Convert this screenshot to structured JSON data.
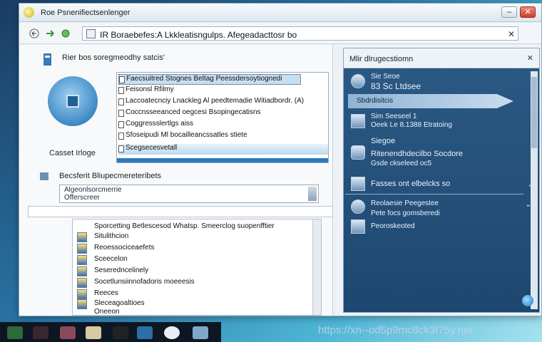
{
  "window": {
    "title": "Roe Psnenifiectsenlenger"
  },
  "toolbar": {
    "address": "IR Boraebefes:A Lkkleatisngulps. Afegeadacttosr bo"
  },
  "left": {
    "top_label": "Rier bos soregmeodhy satcis'",
    "pie_caption": "Casset Irloge",
    "list_items": [
      "Faecsuitred Stognes Beltag Peessdersoytiognedi",
      "Feisonsl Rfilmy",
      "Laccoatecnciy Lnackleg Al peedtemadie Witiadbordr. (A)",
      "Coccnsseeanced oegcesi Bsopingecatisns",
      "Coggressslertlgs aiss",
      "Sfoseipudi Ml bocailleancssatles stiete",
      "Scegsecesvetall"
    ],
    "group_label": "Becsferit Bliupecmereteribets",
    "combo_lines": [
      "Algeonlsorcmerrie",
      "Offerscreer"
    ],
    "detail_header": "Sporcetting Betlescesod Whatsp. Smeerclog suopenfftier",
    "detail_rows": [
      "Situlithcion",
      "Reoessociceaefets",
      "Sceecelon",
      "Seseredncelinely",
      "Socetlunsiinnofadoris moeeesis",
      "Reeces",
      "Sleceagoaltioes",
      "Oneeon"
    ]
  },
  "right": {
    "title": "Mlir dlrugecstiomn",
    "items": [
      {
        "line1": "Sie Seoe",
        "line2": "83 Sc Ltdsee"
      },
      {
        "line1": "Sbdrdisitcis"
      },
      {
        "line1": "Sim Seeseel 1"
      },
      {
        "line1": "Oeek Le 8.1388 Etratoing"
      },
      {
        "line1": "Siegoe"
      },
      {
        "line1": "Ritenendhdecilbo Socdore",
        "line2": "Gsde ckseleed oc5"
      },
      {
        "line1": "Fasses ont elbelcks so"
      },
      {
        "line1": "Reolaesie Peegestee",
        "line2": "Pete focs gomsberedi"
      },
      {
        "line1": "Peoroskeoted"
      }
    ]
  },
  "watermark": "https://xn--od5p9mc8ck3f75y.net",
  "colors": {
    "accent": "#2b78c0",
    "panel": "#1d476f"
  }
}
